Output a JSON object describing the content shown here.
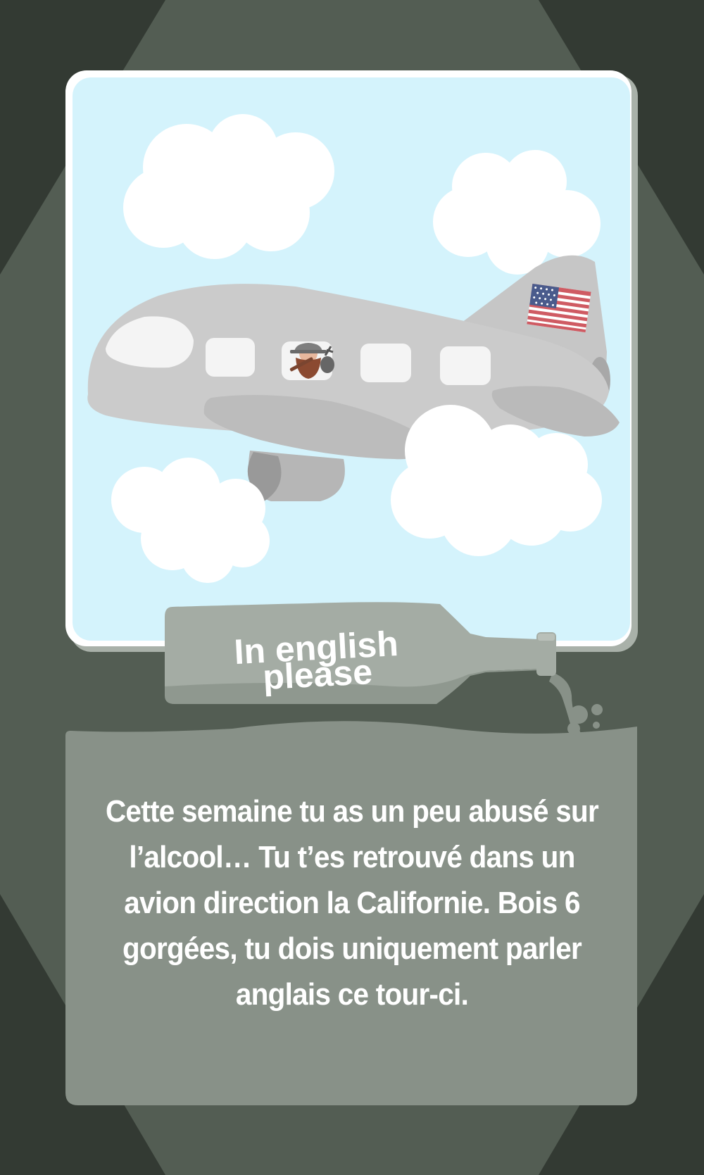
{
  "card": {
    "title_line1": "In english",
    "title_line2": "please",
    "body_text": "Cette semaine tu as un peu abusé sur l’alcool… Tu t’es retrouvé dans un avion direction la Californie. Bois 6 gorgées, tu dois uniquement parler anglais ce tour-ci."
  },
  "illustration": {
    "scene": "airplane-in-clouds",
    "flag": "usa-flag-icon",
    "passenger": "bearded-traveler-icon"
  },
  "colors": {
    "background_dark": "#333a33",
    "background_octagon": "#535d53",
    "sky": "#d4f3fc",
    "frame": "#ffffff",
    "panel": "#889188",
    "bottle": "#a2aaa2",
    "plane": "#c9c9c9",
    "text": "#ffffff"
  }
}
